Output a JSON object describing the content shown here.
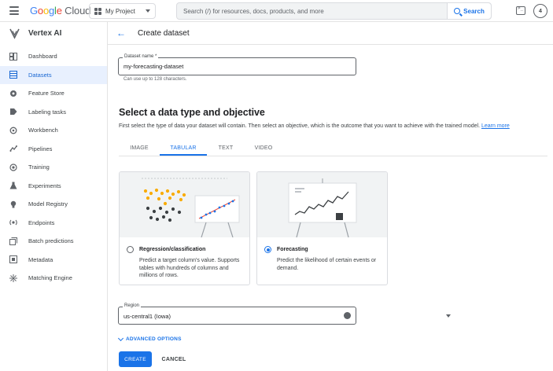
{
  "topbar": {
    "logo_google": [
      "G",
      "o",
      "o",
      "g",
      "l",
      "e"
    ],
    "logo_cloud": "Cloud",
    "project": "My Project",
    "search_placeholder": "Search (/) for resources, docs, products, and more",
    "search_button": "Search",
    "notification_count": "4",
    "icons": {
      "menu": "hamburger-icon",
      "project": "project-dots-icon",
      "search": "search-icon",
      "shell": "cloud-shell-icon"
    }
  },
  "sidebar": {
    "product": "Vertex AI",
    "items": [
      {
        "label": "Dashboard",
        "icon": "dashboard-icon",
        "active": false
      },
      {
        "label": "Datasets",
        "icon": "datasets-icon",
        "active": true
      },
      {
        "label": "Feature Store",
        "icon": "feature-store-icon",
        "active": false
      },
      {
        "label": "Labeling tasks",
        "icon": "label-icon",
        "active": false
      },
      {
        "label": "Workbench",
        "icon": "workbench-icon",
        "active": false
      },
      {
        "label": "Pipelines",
        "icon": "pipelines-icon",
        "active": false
      },
      {
        "label": "Training",
        "icon": "training-icon",
        "active": false
      },
      {
        "label": "Experiments",
        "icon": "experiments-icon",
        "active": false
      },
      {
        "label": "Model Registry",
        "icon": "lightbulb-icon",
        "active": false
      },
      {
        "label": "Endpoints",
        "icon": "endpoints-icon",
        "active": false
      },
      {
        "label": "Batch predictions",
        "icon": "batch-icon",
        "active": false
      },
      {
        "label": "Metadata",
        "icon": "metadata-icon",
        "active": false
      },
      {
        "label": "Matching Engine",
        "icon": "matching-engine-icon",
        "active": false
      }
    ]
  },
  "header": {
    "title": "Create dataset"
  },
  "form": {
    "name_label": "Dataset name *",
    "name_value": "my-forecasting-dataset",
    "name_hint": "Can use up to 128 characters.",
    "section_title": "Select a data type and objective",
    "section_desc": "First select the type of data your dataset will contain. Then select an objective, which is the outcome that you want to achieve with the trained model.",
    "learn_more": "Learn more",
    "tabs": [
      "IMAGE",
      "TABULAR",
      "TEXT",
      "VIDEO"
    ],
    "active_tab": "TABULAR",
    "objectives": [
      {
        "title": "Regression/classification",
        "desc": "Predict a target column's value. Supports tables with hundreds of columns and millions of rows.",
        "selected": false
      },
      {
        "title": "Forecasting",
        "desc": "Predict the likelihood of certain events or demand.",
        "selected": true
      }
    ],
    "region_label": "Region",
    "region_value": "us-central1 (Iowa)",
    "advanced": "ADVANCED OPTIONS",
    "create": "CREATE",
    "cancel": "CANCEL"
  },
  "colors": {
    "accent": "#1a73e8",
    "active_nav_bg": "#e8f0fe",
    "illustration_bg": "#f1f3f4"
  }
}
